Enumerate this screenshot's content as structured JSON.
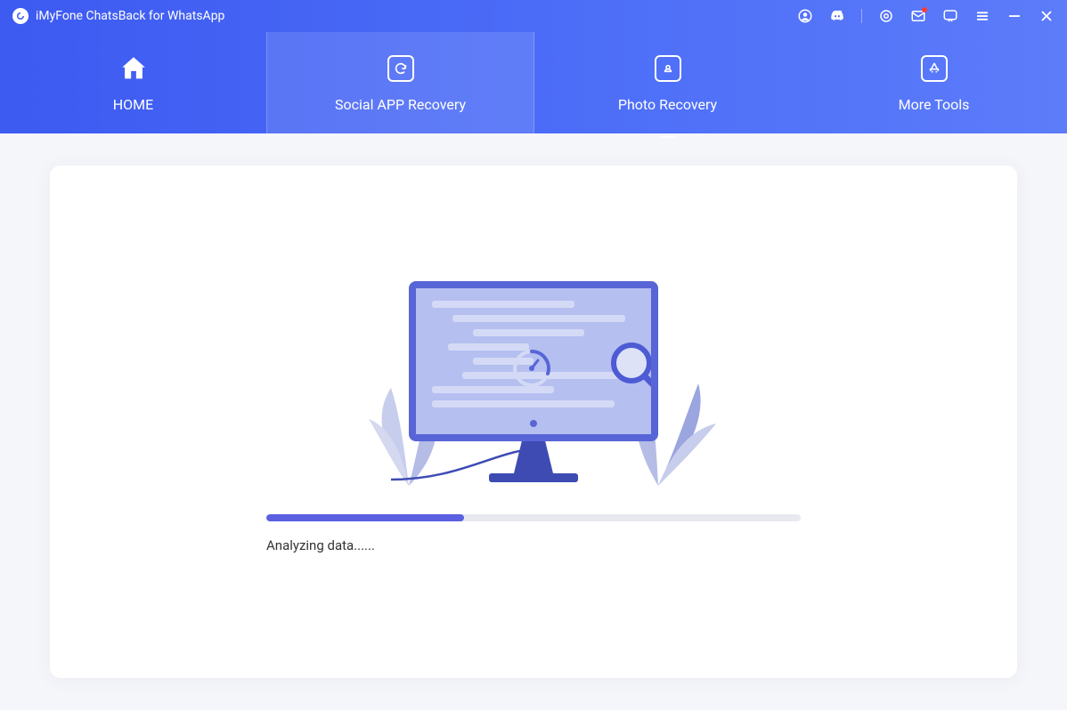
{
  "app": {
    "title": "iMyFone ChatsBack for WhatsApp"
  },
  "nav": {
    "home": "HOME",
    "social": "Social APP Recovery",
    "photo": "Photo Recovery",
    "more": "More Tools",
    "active": "social"
  },
  "progress": {
    "percent": 37,
    "status": "Analyzing data......"
  },
  "colors": {
    "primary": "#5b5fe0",
    "gradient_start": "#3d5af1",
    "gradient_end": "#5c7cfa"
  }
}
